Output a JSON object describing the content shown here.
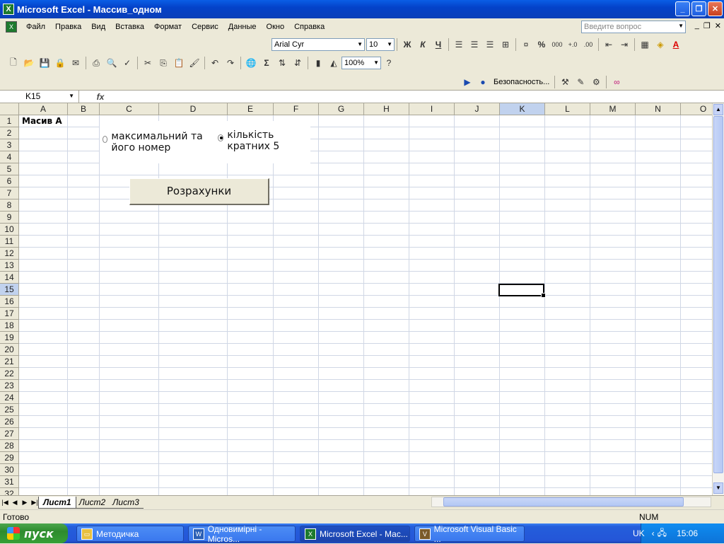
{
  "window": {
    "title": "Microsoft Excel - Массив_одном"
  },
  "menu": {
    "items": [
      "Файл",
      "Правка",
      "Вид",
      "Вставка",
      "Формат",
      "Сервис",
      "Данные",
      "Окно",
      "Справка"
    ],
    "ask_placeholder": "Введите вопрос"
  },
  "format_toolbar": {
    "font": "Arial Cyr",
    "size": "10",
    "bold": "Ж",
    "italic": "К",
    "underline": "Ч",
    "percent": "%",
    "thousands": "000"
  },
  "standard_toolbar": {
    "zoom": "100%",
    "sigma": "Σ"
  },
  "security_toolbar": {
    "label": "Безопасность..."
  },
  "formula_bar": {
    "name_box": "K15",
    "fx": "fx",
    "formula": ""
  },
  "sheet": {
    "columns": [
      "A",
      "B",
      "C",
      "D",
      "E",
      "F",
      "G",
      "H",
      "I",
      "J",
      "K",
      "L",
      "M",
      "N",
      "O"
    ],
    "rows": [
      "1",
      "2",
      "3",
      "4",
      "5",
      "6",
      "7",
      "8",
      "9",
      "10",
      "11",
      "12",
      "13",
      "14",
      "15",
      "16",
      "17",
      "18",
      "19",
      "20",
      "21",
      "22",
      "23",
      "24",
      "25",
      "26",
      "27",
      "28",
      "29",
      "30",
      "31",
      "32"
    ],
    "selected_column": "K",
    "selected_row": "15",
    "cell_a1": "Масив А"
  },
  "controls": {
    "option1": "максимальний та його номер",
    "option2": "кількість кратних 5",
    "selected_option": 2,
    "calc_button": "Розрахунки"
  },
  "tabs": [
    "Лист1",
    "Лист2",
    "Лист3"
  ],
  "active_tab": "Лист1",
  "status": {
    "ready": "Готово",
    "num": "NUM"
  },
  "taskbar": {
    "start": "пуск",
    "tasks": [
      "Методичка",
      "Одновимірні - Micros...",
      "Microsoft Excel - Мас...",
      "Microsoft Visual Basic ..."
    ],
    "lang": "UK",
    "clock": "15:06"
  }
}
